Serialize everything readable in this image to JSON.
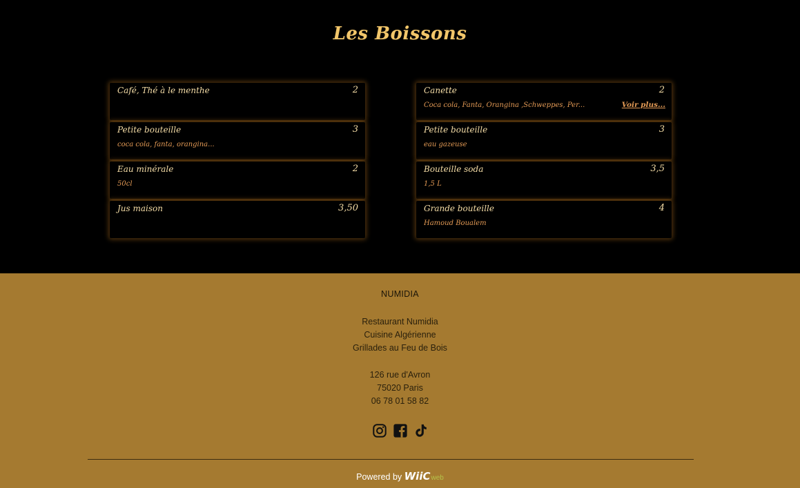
{
  "menu": {
    "title": "Les Boissons",
    "left_items": [
      {
        "name": "Café, Thé à le menthe",
        "price": "2",
        "desc": ""
      },
      {
        "name": "Petite bouteille",
        "price": "3",
        "desc": "coca cola, fanta, orangina..."
      },
      {
        "name": "Eau minérale",
        "price": "2",
        "desc": "50cl"
      },
      {
        "name": "Jus maison",
        "price": "3,50",
        "desc": ""
      }
    ],
    "right_items": [
      {
        "name": "Canette",
        "price": "2",
        "desc": "Coca cola, Fanta, Orangina ,Schweppes, Per...",
        "more": "Voir plus..."
      },
      {
        "name": "Petite bouteille",
        "price": "3",
        "desc": "eau gazeuse"
      },
      {
        "name": "Bouteille soda",
        "price": "3,5",
        "desc": "1,5 L"
      },
      {
        "name": "Grande bouteille",
        "price": "4",
        "desc": "Hamoud Boualem"
      }
    ]
  },
  "footer": {
    "brand": "NUMIDIA",
    "description_lines": [
      "Restaurant Numidia",
      "Cuisine Algérienne",
      "Grillades au Feu de Bois"
    ],
    "address_lines": [
      "126 rue d'Avron",
      "75020 Paris",
      "06 78 01 58 82"
    ],
    "socials": [
      "instagram-icon",
      "facebook-icon",
      "tiktok-icon"
    ],
    "powered_by": "Powered by",
    "logo_text": "WiiC",
    "logo_suffix": "web"
  },
  "colors": {
    "background": "#000000",
    "title": "#f2c66a",
    "item_name": "#f4dca6",
    "item_desc": "#e39a55",
    "footer_bg": "#a57a30"
  }
}
